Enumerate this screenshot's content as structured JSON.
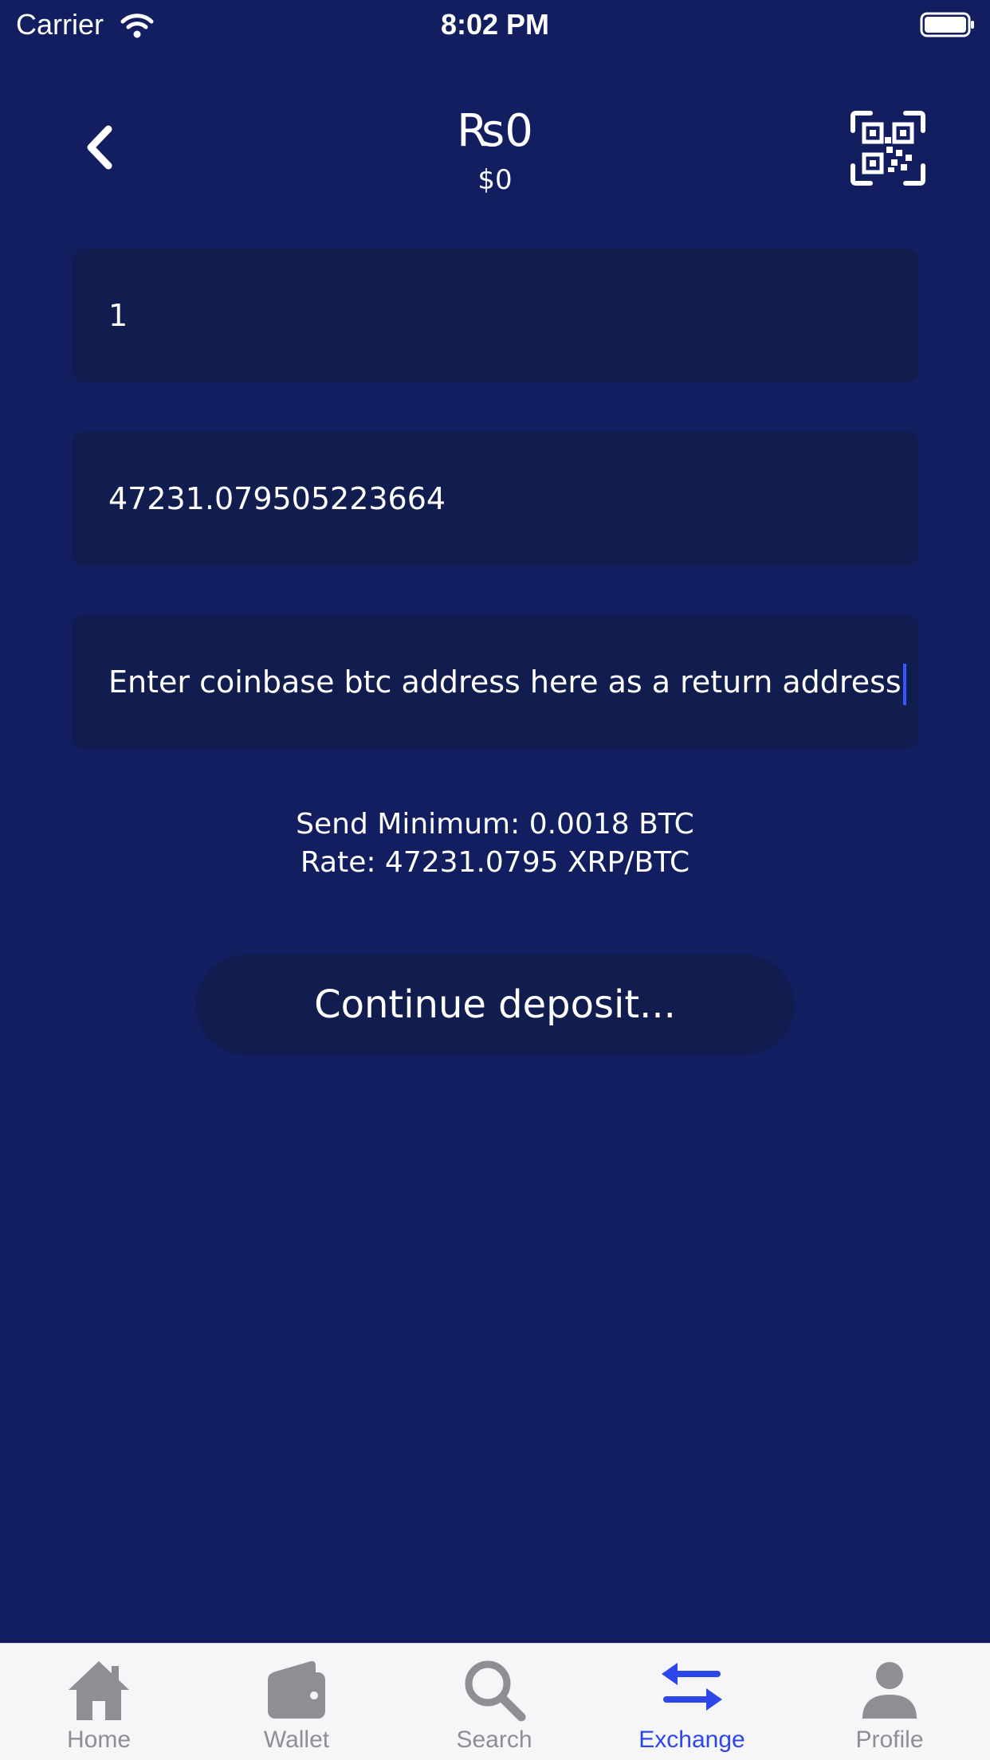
{
  "status_bar": {
    "carrier": "Carrier",
    "time": "8:02 PM"
  },
  "header": {
    "balance_primary": "₨0",
    "balance_secondary": "$0"
  },
  "form": {
    "amount_value": "1",
    "converted_value": "47231.079505223664",
    "address_placeholder": "Enter coinbase btc address here as a return address"
  },
  "info": {
    "send_minimum": "Send Minimum: 0.0018 BTC",
    "rate": "Rate: 47231.0795 XRP/BTC"
  },
  "continue_button": {
    "label": "Continue deposit..."
  },
  "tab_bar": {
    "active": "Exchange",
    "active_color": "#2d46e8",
    "inactive_color": "#8e8e93",
    "items": [
      {
        "label": "Home",
        "icon": "home-icon"
      },
      {
        "label": "Wallet",
        "icon": "wallet-icon"
      },
      {
        "label": "Search",
        "icon": "search-icon"
      },
      {
        "label": "Exchange",
        "icon": "exchange-icon"
      },
      {
        "label": "Profile",
        "icon": "profile-icon"
      }
    ]
  },
  "colors": {
    "background": "#121e5f",
    "field_background": "#111c4f",
    "caret": "#3a55ff"
  }
}
